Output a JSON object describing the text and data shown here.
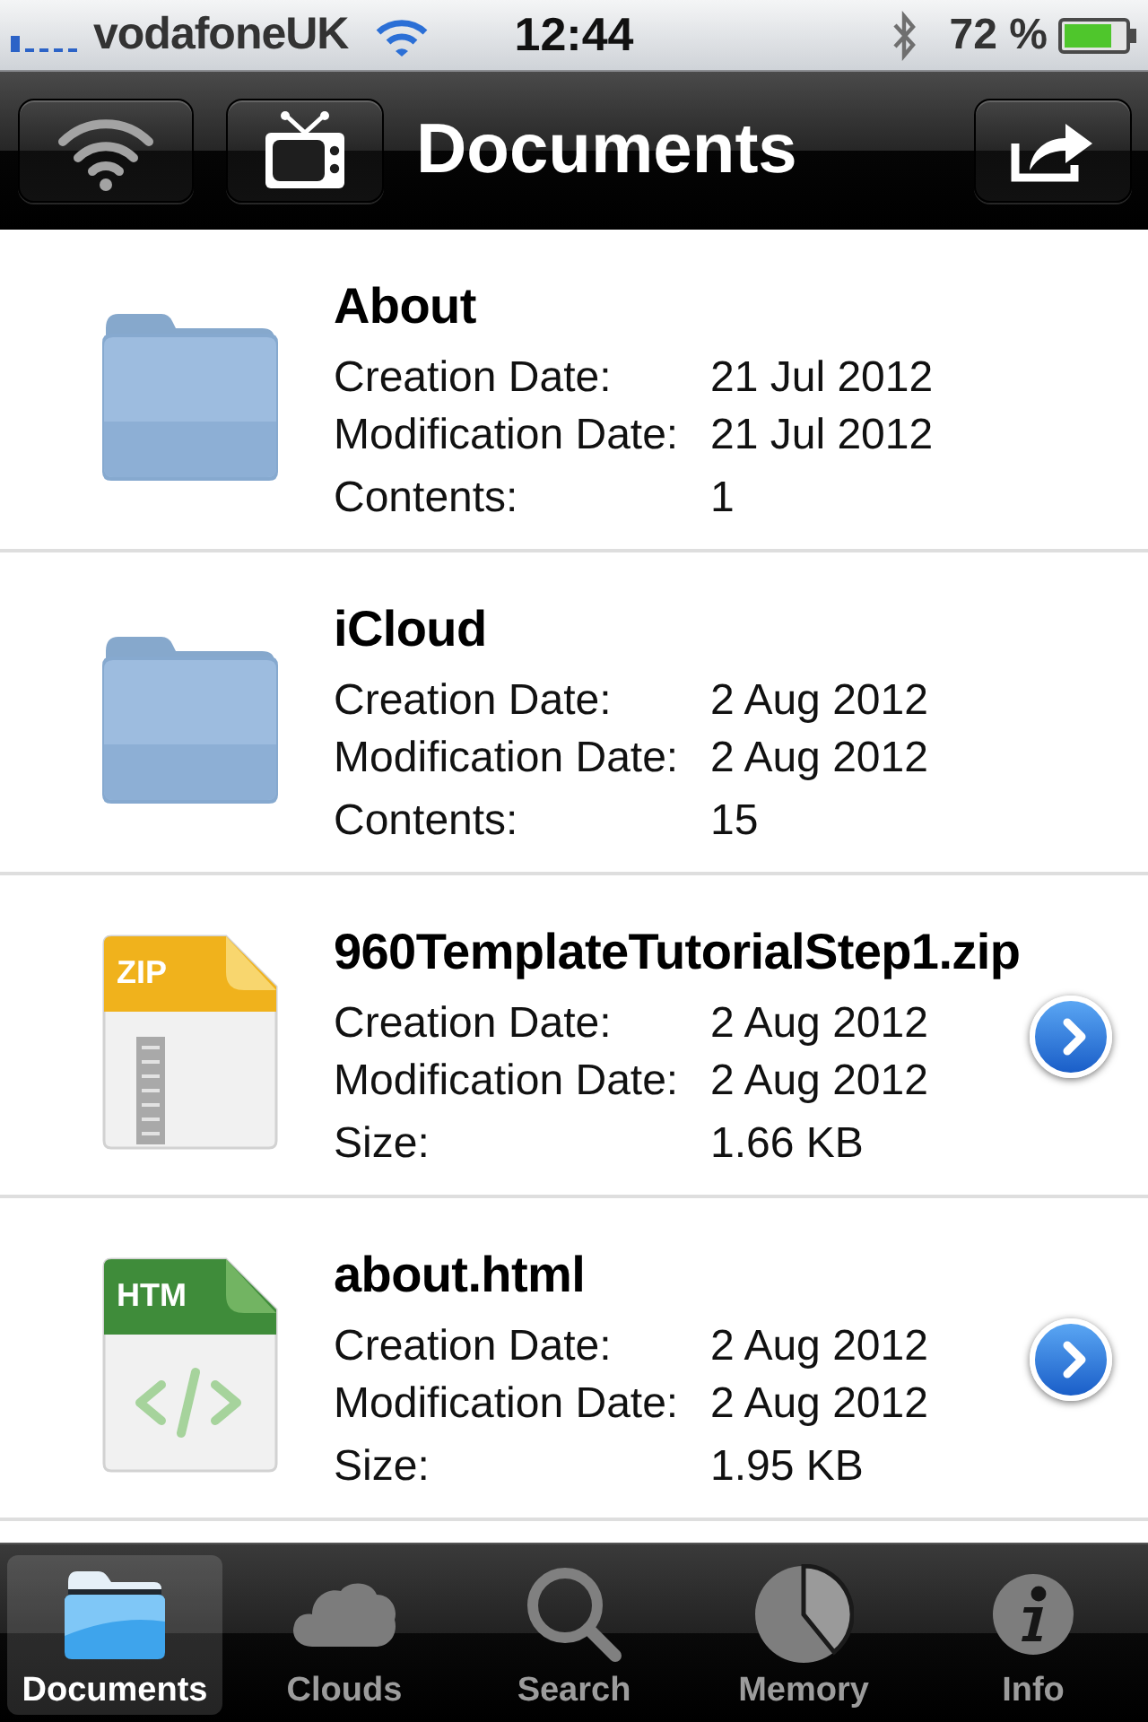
{
  "status_bar": {
    "carrier": "vodafoneUK",
    "time": "12:44",
    "battery": "72 %"
  },
  "nav_bar": {
    "title": "Documents"
  },
  "items": [
    {
      "kind": "folder",
      "name": "About",
      "details": [
        {
          "label": "Creation Date:",
          "value": "21 Jul 2012"
        },
        {
          "label": "Modification Date:",
          "value": "21 Jul 2012"
        },
        {
          "label": "Contents:",
          "value": "1"
        }
      ],
      "detail_button": false
    },
    {
      "kind": "folder",
      "name": "iCloud",
      "details": [
        {
          "label": "Creation Date:",
          "value": "2 Aug 2012"
        },
        {
          "label": "Modification Date:",
          "value": "2 Aug 2012"
        },
        {
          "label": "Contents:",
          "value": "15"
        }
      ],
      "detail_button": false
    },
    {
      "kind": "zip",
      "icon_label": "ZIP",
      "name": "960TemplateTutorialStep1.zip",
      "details": [
        {
          "label": "Creation Date:",
          "value": "2 Aug 2012"
        },
        {
          "label": "Modification Date:",
          "value": "2 Aug 2012"
        },
        {
          "label": "Size:",
          "value": "1.66 KB"
        }
      ],
      "detail_button": true
    },
    {
      "kind": "html",
      "icon_label": "HTM",
      "name": "about.html",
      "details": [
        {
          "label": "Creation Date:",
          "value": "2 Aug 2012"
        },
        {
          "label": "Modification Date:",
          "value": "2 Aug 2012"
        },
        {
          "label": "Size:",
          "value": "1.95 KB"
        }
      ],
      "detail_button": true
    }
  ],
  "tab_bar": [
    {
      "label": "Documents",
      "selected": true
    },
    {
      "label": "Clouds",
      "selected": false
    },
    {
      "label": "Search",
      "selected": false
    },
    {
      "label": "Memory",
      "selected": false
    },
    {
      "label": "Info",
      "selected": false
    }
  ]
}
